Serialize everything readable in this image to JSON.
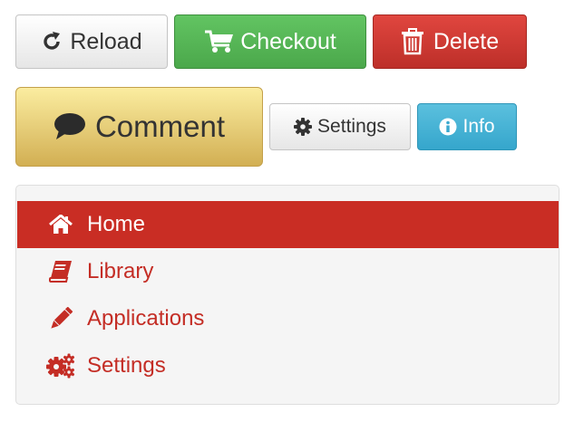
{
  "toolbar": {
    "reload_label": "Reload",
    "checkout_label": "Checkout",
    "delete_label": "Delete",
    "comment_label": "Comment",
    "settings_label": "Settings",
    "info_label": "Info"
  },
  "nav": {
    "items": [
      {
        "label": "Home",
        "icon": "home-icon",
        "active": true
      },
      {
        "label": "Library",
        "icon": "book-icon",
        "active": false
      },
      {
        "label": "Applications",
        "icon": "pencil-icon",
        "active": false
      },
      {
        "label": "Settings",
        "icon": "gears-icon",
        "active": false
      }
    ]
  },
  "colors": {
    "nav_accent": "#c92d24",
    "success": "#5cb85c",
    "danger": "#d9534f",
    "warning_gold": "#e6c970",
    "info": "#5bc0de"
  }
}
